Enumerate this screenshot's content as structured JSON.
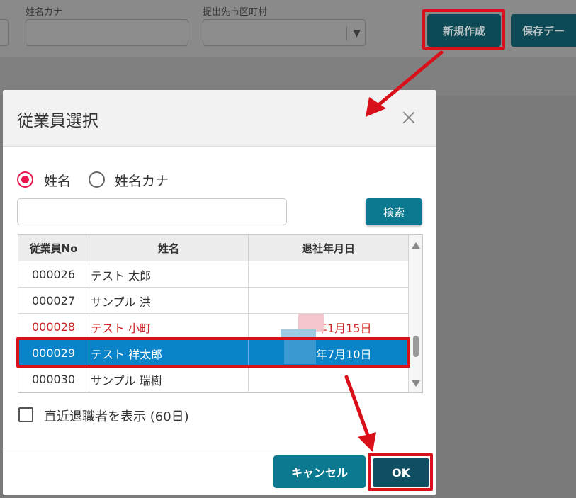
{
  "background": {
    "fields": [
      {
        "label": "姓名カナ",
        "value": ""
      },
      {
        "label": "提出先市区町村",
        "value": "",
        "arrow": "▼"
      }
    ],
    "buttons": {
      "new": "新規作成",
      "saved": "保存デー"
    }
  },
  "dialog": {
    "title": "従業員選択",
    "close_icon": "×",
    "search_mode": {
      "options": [
        "姓名",
        "姓名カナ"
      ],
      "selected": "姓名"
    },
    "search_input": {
      "value": "",
      "placeholder": ""
    },
    "search_button": "検索",
    "table": {
      "columns": [
        "従業員No",
        "姓名",
        "退社年月日"
      ],
      "rows": [
        {
          "no": "000026",
          "name": "テスト 太郎",
          "leave_date": "",
          "state": "normal"
        },
        {
          "no": "000027",
          "name": "サンプル 洪",
          "leave_date": "",
          "state": "normal"
        },
        {
          "no": "000028",
          "name": "テスト 小町",
          "leave_date": "年1月15日",
          "state": "retired"
        },
        {
          "no": "000029",
          "name": "テスト 祥太郎",
          "leave_date": "年7月10日",
          "state": "selected"
        },
        {
          "no": "000030",
          "name": "サンプル 瑞樹",
          "leave_date": "",
          "state": "normal"
        }
      ]
    },
    "show_recent_retired": {
      "label": "直近退職者を表示 (60日)",
      "checked": false
    },
    "footer": {
      "cancel": "キャンセル",
      "ok": "OK"
    }
  },
  "colors": {
    "accent_pink": "#e8174e",
    "teal_button": "#0b7a91",
    "selected_row": "#0a84c8",
    "retired_text": "#cc2222",
    "annotation_red": "#d8101a"
  }
}
